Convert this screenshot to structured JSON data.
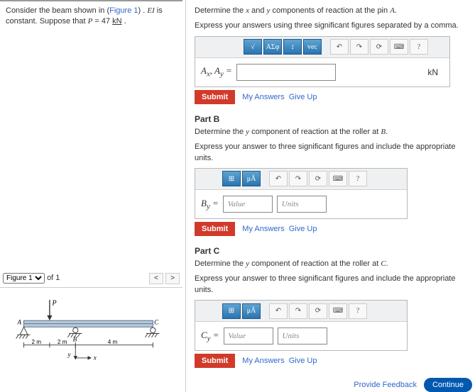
{
  "problem": {
    "text_parts": [
      "Consider the beam shown in (",
      "Figure 1",
      ") . ",
      "EI",
      " is constant. Suppose that ",
      "P",
      " = 47 ",
      "kN",
      " ."
    ],
    "figure_link": "Figure 1"
  },
  "figure_nav": {
    "selected": "Figure 1",
    "of_label": "of 1"
  },
  "figure": {
    "P_label": "P",
    "A_label": "A",
    "B_label": "B",
    "C_label": "C",
    "dim1": "2 m",
    "dim2": "2 m",
    "dim3": "4 m",
    "x_label": "x",
    "y_label": "y"
  },
  "partA": {
    "q1": "Determine the ",
    "q2": " and ",
    "q3": " components of reaction at the pin ",
    "var_x": "x",
    "var_y": "y",
    "var_A": "A",
    "q_end": ".",
    "express": "Express your answers using three significant figures separated by a comma.",
    "label": "Aₓ, A_y =",
    "units": "kN",
    "tb": [
      "√",
      "ΑΣφ",
      "↕",
      "vec",
      "↶",
      "↷",
      "⟳",
      "⌨",
      "?"
    ]
  },
  "partB": {
    "header": "Part B",
    "q1": "Determine the ",
    "var_y": "y",
    "q2": " component of reaction at the roller at ",
    "var_B": "B",
    "q_end": ".",
    "express": "Express your answer to three significant figures and include the appropriate units.",
    "label": "B_y =",
    "value_ph": "Value",
    "units_ph": "Units",
    "tb": [
      "⊞",
      "μÅ",
      "↶",
      "↷",
      "⟳",
      "⌨",
      "?"
    ]
  },
  "partC": {
    "header": "Part C",
    "q1": "Determine the ",
    "var_y": "y",
    "q2": " component of reaction at the roller at ",
    "var_C": "C",
    "q_end": ".",
    "express": "Express your answer to three significant figures and include the appropriate units.",
    "label": "C_y =",
    "value_ph": "Value",
    "units_ph": "Units",
    "tb": [
      "⊞",
      "μÅ",
      "↶",
      "↷",
      "⟳",
      "⌨",
      "?"
    ]
  },
  "common": {
    "submit": "Submit",
    "my_answers": "My Answers",
    "give_up": "Give Up",
    "provide_feedback": "Provide Feedback",
    "continue": "Continue"
  }
}
